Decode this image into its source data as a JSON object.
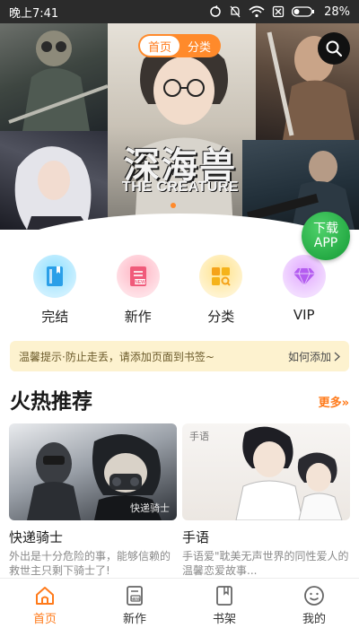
{
  "status_bar": {
    "time": "晚上7:41",
    "battery": "28%"
  },
  "banner": {
    "tabs": [
      {
        "label": "首页",
        "active": true
      },
      {
        "label": "分类",
        "active": false
      }
    ],
    "title_cn": "深海兽",
    "title_en": "THE CREATURE",
    "download_app": "下载\nAPP"
  },
  "categories": [
    {
      "label": "完结",
      "icon": "book-icon",
      "color": "#3fb8f5"
    },
    {
      "label": "新作",
      "icon": "new-document-icon",
      "color": "#f05a7a"
    },
    {
      "label": "分类",
      "icon": "grid-search-icon",
      "color": "#f5b31a"
    },
    {
      "label": "VIP",
      "icon": "diamond-icon",
      "color": "#b45cf0"
    }
  ],
  "notice": {
    "message": "温馨提示·防止走丢，请添加页面到书签~",
    "link": "如何添加"
  },
  "section": {
    "title": "火热推荐",
    "more": "更多»"
  },
  "cards": [
    {
      "name": "快递骑士",
      "desc": "外出是十分危险的事，能够信赖的救世主只剩下骑士了!",
      "cover_label": "快递骑士"
    },
    {
      "name": "手语",
      "desc": "手语爱\"耽美无声世界的同性爱人的温馨恋爱故事...",
      "cover_label": "手语"
    }
  ],
  "bottom_nav": [
    {
      "label": "首页",
      "icon": "home-icon",
      "active": true
    },
    {
      "label": "新作",
      "icon": "new-book-icon",
      "active": false
    },
    {
      "label": "书架",
      "icon": "bookshelf-icon",
      "active": false
    },
    {
      "label": "我的",
      "icon": "smiley-icon",
      "active": false
    }
  ],
  "colors": {
    "accent": "#ff7a1a",
    "download_green": "#1fa53f",
    "notice_bg": "#fdf2cf"
  }
}
